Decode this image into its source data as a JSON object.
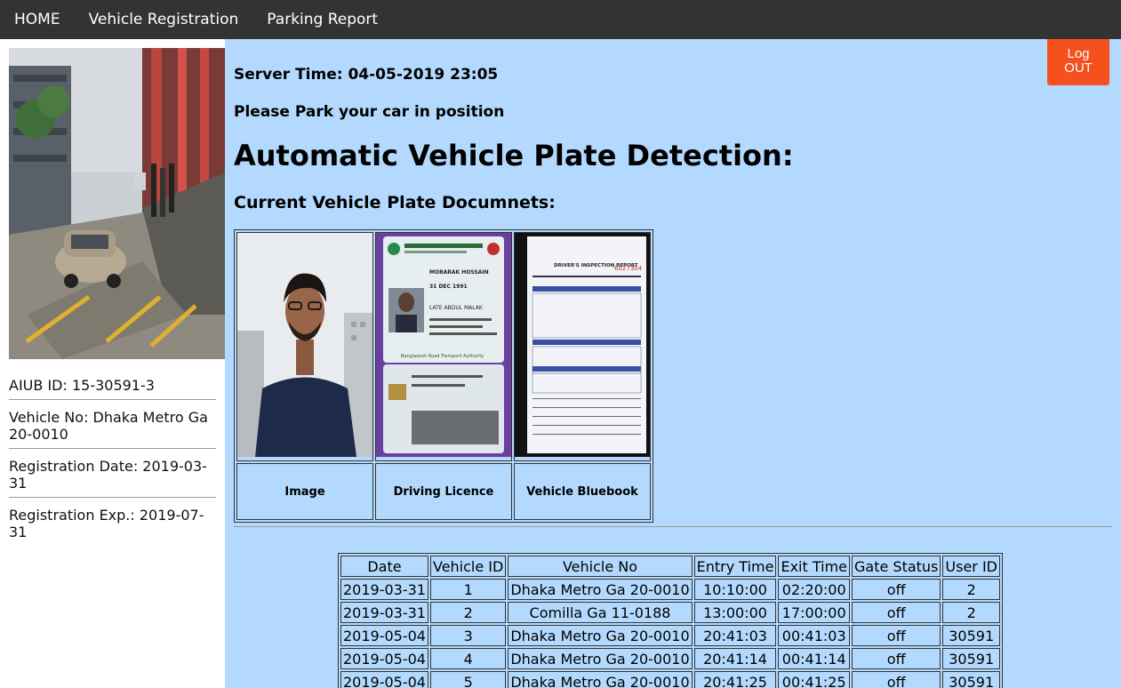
{
  "nav": {
    "items": [
      "HOME",
      "Vehicle Registration",
      "Parking Report"
    ]
  },
  "sidebar": {
    "aiub_id": "AIUB ID: 15-30591-3",
    "vehicle_no": "Vehicle No: Dhaka Metro Ga 20-0010",
    "registration_date": "Registration Date: 2019-03-31",
    "registration_exp": "Registration Exp.: 2019-07-31"
  },
  "logout": {
    "line1": "Log",
    "line2": "OUT"
  },
  "main": {
    "server_time": "Server Time: 04-05-2019 23:05",
    "park_message": "Please Park your car in position",
    "title": "Automatic Vehicle Plate Detection:",
    "docs_title": "Current Vehicle Plate Documnets:",
    "documents": [
      "Image",
      "Driving Licence",
      "Vehicle Bluebook"
    ]
  },
  "license_card": {
    "name": "MOBARAK HOSSAIN",
    "dob": "31 DEC 1991",
    "father": "LATE ABDUL MALAK",
    "authority": "Bangladesh Road Transport Authority"
  },
  "report_form": {
    "title": "DRIVER'S INSPECTION REPORT",
    "number": "6027304"
  },
  "parking_table": {
    "headers": [
      "Date",
      "Vehicle ID",
      "Vehicle No",
      "Entry Time",
      "Exit Time",
      "Gate Status",
      "User ID"
    ],
    "rows": [
      [
        "2019-03-31",
        "1",
        "Dhaka Metro Ga 20-0010",
        "10:10:00",
        "02:20:00",
        "off",
        "2"
      ],
      [
        "2019-03-31",
        "2",
        "Comilla Ga 11-0188",
        "13:00:00",
        "17:00:00",
        "off",
        "2"
      ],
      [
        "2019-05-04",
        "3",
        "Dhaka Metro Ga 20-0010",
        "20:41:03",
        "00:41:03",
        "off",
        "30591"
      ],
      [
        "2019-05-04",
        "4",
        "Dhaka Metro Ga 20-0010",
        "20:41:14",
        "00:41:14",
        "off",
        "30591"
      ],
      [
        "2019-05-04",
        "5",
        "Dhaka Metro Ga 20-0010",
        "20:41:25",
        "00:41:25",
        "off",
        "30591"
      ]
    ]
  }
}
